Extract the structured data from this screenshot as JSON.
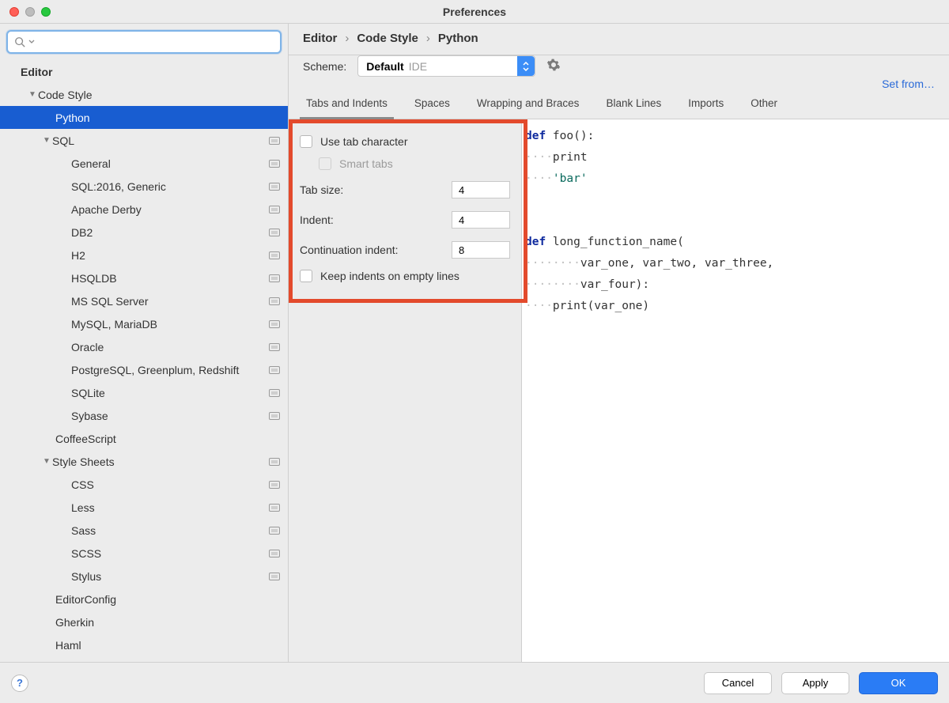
{
  "window": {
    "title": "Preferences"
  },
  "search": {
    "placeholder": ""
  },
  "nav": {
    "root": "Editor",
    "items": [
      {
        "label": "Code Style",
        "level": 1,
        "expand": true,
        "caret": "▼"
      },
      {
        "label": "Python",
        "level": 2,
        "selected": true
      },
      {
        "label": "SQL",
        "level": 2,
        "expand": true,
        "caret": "▼",
        "badge": true
      },
      {
        "label": "General",
        "level": 3,
        "badge": true
      },
      {
        "label": "SQL:2016, Generic",
        "level": 3,
        "badge": true
      },
      {
        "label": "Apache Derby",
        "level": 3,
        "badge": true
      },
      {
        "label": "DB2",
        "level": 3,
        "badge": true
      },
      {
        "label": "H2",
        "level": 3,
        "badge": true
      },
      {
        "label": "HSQLDB",
        "level": 3,
        "badge": true
      },
      {
        "label": "MS SQL Server",
        "level": 3,
        "badge": true
      },
      {
        "label": "MySQL, MariaDB",
        "level": 3,
        "badge": true
      },
      {
        "label": "Oracle",
        "level": 3,
        "badge": true
      },
      {
        "label": "PostgreSQL, Greenplum, Redshift",
        "level": 3,
        "badge": true
      },
      {
        "label": "SQLite",
        "level": 3,
        "badge": true
      },
      {
        "label": "Sybase",
        "level": 3,
        "badge": true
      },
      {
        "label": "CoffeeScript",
        "level": 2
      },
      {
        "label": "Style Sheets",
        "level": 2,
        "expand": true,
        "caret": "▼",
        "badge": true
      },
      {
        "label": "CSS",
        "level": 3,
        "badge": true
      },
      {
        "label": "Less",
        "level": 3,
        "badge": true
      },
      {
        "label": "Sass",
        "level": 3,
        "badge": true
      },
      {
        "label": "SCSS",
        "level": 3,
        "badge": true
      },
      {
        "label": "Stylus",
        "level": 3,
        "badge": true
      },
      {
        "label": "EditorConfig",
        "level": 2
      },
      {
        "label": "Gherkin",
        "level": 2
      },
      {
        "label": "Haml",
        "level": 2
      }
    ]
  },
  "breadcrumb": [
    "Editor",
    "Code Style",
    "Python"
  ],
  "scheme": {
    "label": "Scheme:",
    "value": "Default",
    "suffix": "IDE"
  },
  "set_from": "Set from…",
  "tabs": [
    "Tabs and Indents",
    "Spaces",
    "Wrapping and Braces",
    "Blank Lines",
    "Imports",
    "Other"
  ],
  "active_tab": 0,
  "settings": {
    "use_tab_char": {
      "label": "Use tab character",
      "checked": false
    },
    "smart_tabs": {
      "label": "Smart tabs",
      "checked": false,
      "disabled": true
    },
    "tab_size": {
      "label": "Tab size:",
      "value": "4"
    },
    "indent": {
      "label": "Indent:",
      "value": "4"
    },
    "cont_indent": {
      "label": "Continuation indent:",
      "value": "8"
    },
    "keep_empty": {
      "label": "Keep indents on empty lines",
      "checked": false
    }
  },
  "code": {
    "l1_kw": "def",
    "l1_rest": " foo():",
    "l2_dots": "····",
    "l2_rest": "print",
    "l3_dots": "····",
    "l3_str": "'bar'",
    "l5_kw": "def",
    "l5_rest": " long_function_name(",
    "l6_dots": "········",
    "l6_rest": "var_one, var_two, var_three,",
    "l7_dots": "········",
    "l7_rest": "var_four):",
    "l8_dots": "····",
    "l8_rest": "print(var_one)"
  },
  "footer": {
    "help": "?",
    "cancel": "Cancel",
    "apply": "Apply",
    "ok": "OK"
  }
}
